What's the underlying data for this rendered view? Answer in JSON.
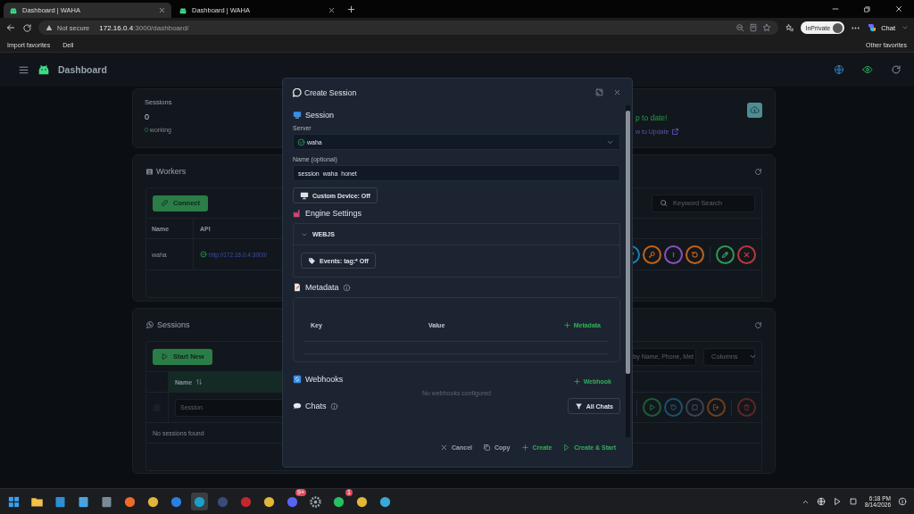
{
  "browser": {
    "tabs": [
      {
        "title": "Dashboard | WAHA",
        "selected": true
      },
      {
        "title": "Dashboard | WAHA",
        "selected": false
      }
    ],
    "security": "Not secure",
    "url_host": "172.16.0.4",
    "url_rest": ":3000/dashboard/",
    "inprivate": "InPrivate",
    "chat": "Chat",
    "favorites": [
      "Import favorites",
      "Dell"
    ],
    "other_favorites": "Other favorites"
  },
  "header": {
    "title": "Dashboard"
  },
  "stats": {
    "label": "Sessions",
    "value": "0",
    "working_count": "0",
    "working_label": "working",
    "update_status": "p to date!",
    "update_link": "w to Update"
  },
  "workers": {
    "title": "Workers",
    "connect": "Connect",
    "search_placeholder": "Keyword Search",
    "columns": [
      "Name",
      "API"
    ],
    "rows": [
      {
        "name": "waha",
        "api": "http://172.16.0.4:3000/",
        "online": true
      }
    ],
    "actions": [
      {
        "kind": "link",
        "color": "#1b7fb8"
      },
      {
        "kind": "key",
        "color": "#c2631c"
      },
      {
        "kind": "info",
        "color": "#8a4fc4"
      },
      {
        "kind": "restart",
        "color": "#c2631c"
      },
      {
        "kind": "divider"
      },
      {
        "kind": "edit",
        "color": "#2f9a55"
      },
      {
        "kind": "delete",
        "color": "#b83a3a"
      }
    ]
  },
  "sessions": {
    "title": "Sessions",
    "start": "Start New",
    "search_placeholder": "by Name, Phone, Met",
    "columns_button": "Columns",
    "name_column": "Name",
    "filter_placeholder": "Session",
    "empty": "No sessions found",
    "actions": [
      {
        "kind": "divider"
      },
      {
        "kind": "play",
        "color": "#1f5c38"
      },
      {
        "kind": "restart",
        "color": "#1c4f6e"
      },
      {
        "kind": "stop",
        "color": "#3a4350"
      },
      {
        "kind": "logout",
        "color": "#6b3f1f"
      },
      {
        "kind": "divider"
      },
      {
        "kind": "delete",
        "color": "#5e2626"
      }
    ],
    "select_all_checked": false
  },
  "modal": {
    "title": "Create Session",
    "session_heading": "Session",
    "server_label": "Server",
    "server_value": "waha",
    "server_online": true,
    "name_label": "Name (optional)",
    "name_value": "session_waha_honet",
    "custom_device": "Custom Device: Off",
    "engine_heading": "Engine Settings",
    "engine": {
      "label": "WEBJS",
      "expanded": true,
      "events_button": "Events: tag:* Off"
    },
    "metadata_heading": "Metadata",
    "metadata_columns": [
      "Key",
      "Value"
    ],
    "add_metadata": "Metadata",
    "webhooks_heading": "Webhooks",
    "add_webhook": "Webhook",
    "webhooks_empty": "No webhooks configured",
    "chats_heading": "Chats",
    "chats_filter": "All Chats",
    "footer": [
      {
        "kind": "cancel",
        "label": "Cancel"
      },
      {
        "kind": "copy",
        "label": "Copy"
      },
      {
        "kind": "create",
        "label": "Create"
      },
      {
        "kind": "start",
        "label": "Create & Start"
      }
    ]
  },
  "taskbar": {
    "time": "6:18 PM",
    "date": "8/14/2026",
    "apps": [
      {
        "kind": "windows",
        "color": "#3aa0f0"
      },
      {
        "kind": "folder",
        "color": "#f2c04a"
      },
      {
        "kind": "square",
        "color": "#2c8fd6"
      },
      {
        "kind": "square",
        "color": "#4aa3e0"
      },
      {
        "kind": "square",
        "color": "#7a8a99"
      },
      {
        "kind": "circle",
        "color": "#f06a2a"
      },
      {
        "kind": "circle",
        "color": "#e0b73a"
      },
      {
        "kind": "circle",
        "color": "#2a7fe0"
      },
      {
        "kind": "circle",
        "color": "#1aa0c8",
        "selected": true
      },
      {
        "kind": "circle",
        "color": "#3a4a7a"
      },
      {
        "kind": "circle",
        "color": "#c4262e"
      },
      {
        "kind": "circle",
        "color": "#e0b73a"
      },
      {
        "kind": "circle",
        "color": "#5865f2",
        "badge": "9+"
      },
      {
        "kind": "gear",
        "color": "#9aa3ad"
      },
      {
        "kind": "circle",
        "color": "#25c160",
        "badge": "1"
      },
      {
        "kind": "circle",
        "color": "#e0b73a"
      },
      {
        "kind": "circle",
        "color": "#3aa8d8"
      }
    ]
  }
}
